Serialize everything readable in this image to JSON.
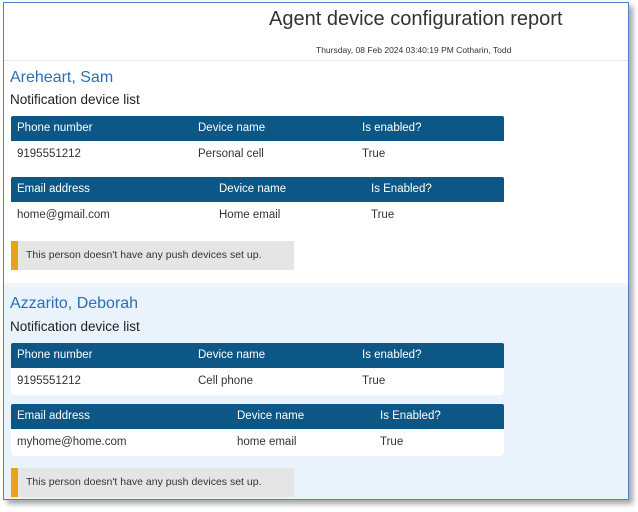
{
  "report": {
    "title": "Agent device configuration report",
    "meta": "Thursday, 08 Feb 2024 03:40:19 PM Cotharin, Todd"
  },
  "agents": [
    {
      "name": "Areheart, Sam",
      "list_title": "Notification device list",
      "phone_table": {
        "headers": [
          "Phone number",
          "Device name",
          "Is enabled?"
        ],
        "row": [
          "9195551212",
          "Personal cell",
          "True"
        ]
      },
      "email_table": {
        "headers": [
          "Email address",
          "Device name",
          "Is Enabled?"
        ],
        "row": [
          "home@gmail.com",
          "Home email",
          "True"
        ]
      },
      "push_notice": "This person doesn't have any push devices set up."
    },
    {
      "name": "Azzarito, Deborah",
      "list_title": "Notification device list",
      "phone_table": {
        "headers": [
          "Phone number",
          "Device name",
          "Is enabled?"
        ],
        "row": [
          "9195551212",
          "Cell phone",
          "True"
        ]
      },
      "email_table": {
        "headers": [
          "Email address",
          "Device name",
          "Is Enabled?"
        ],
        "row": [
          "myhome@home.com",
          "home email",
          "True"
        ]
      },
      "push_notice": "This person doesn't have any push devices set up."
    }
  ],
  "colors": {
    "table_header": "#0d5787",
    "agent_name": "#2a6fb6",
    "notice_accent": "#e8a317",
    "alt_section_bg": "#eaf2fb"
  }
}
